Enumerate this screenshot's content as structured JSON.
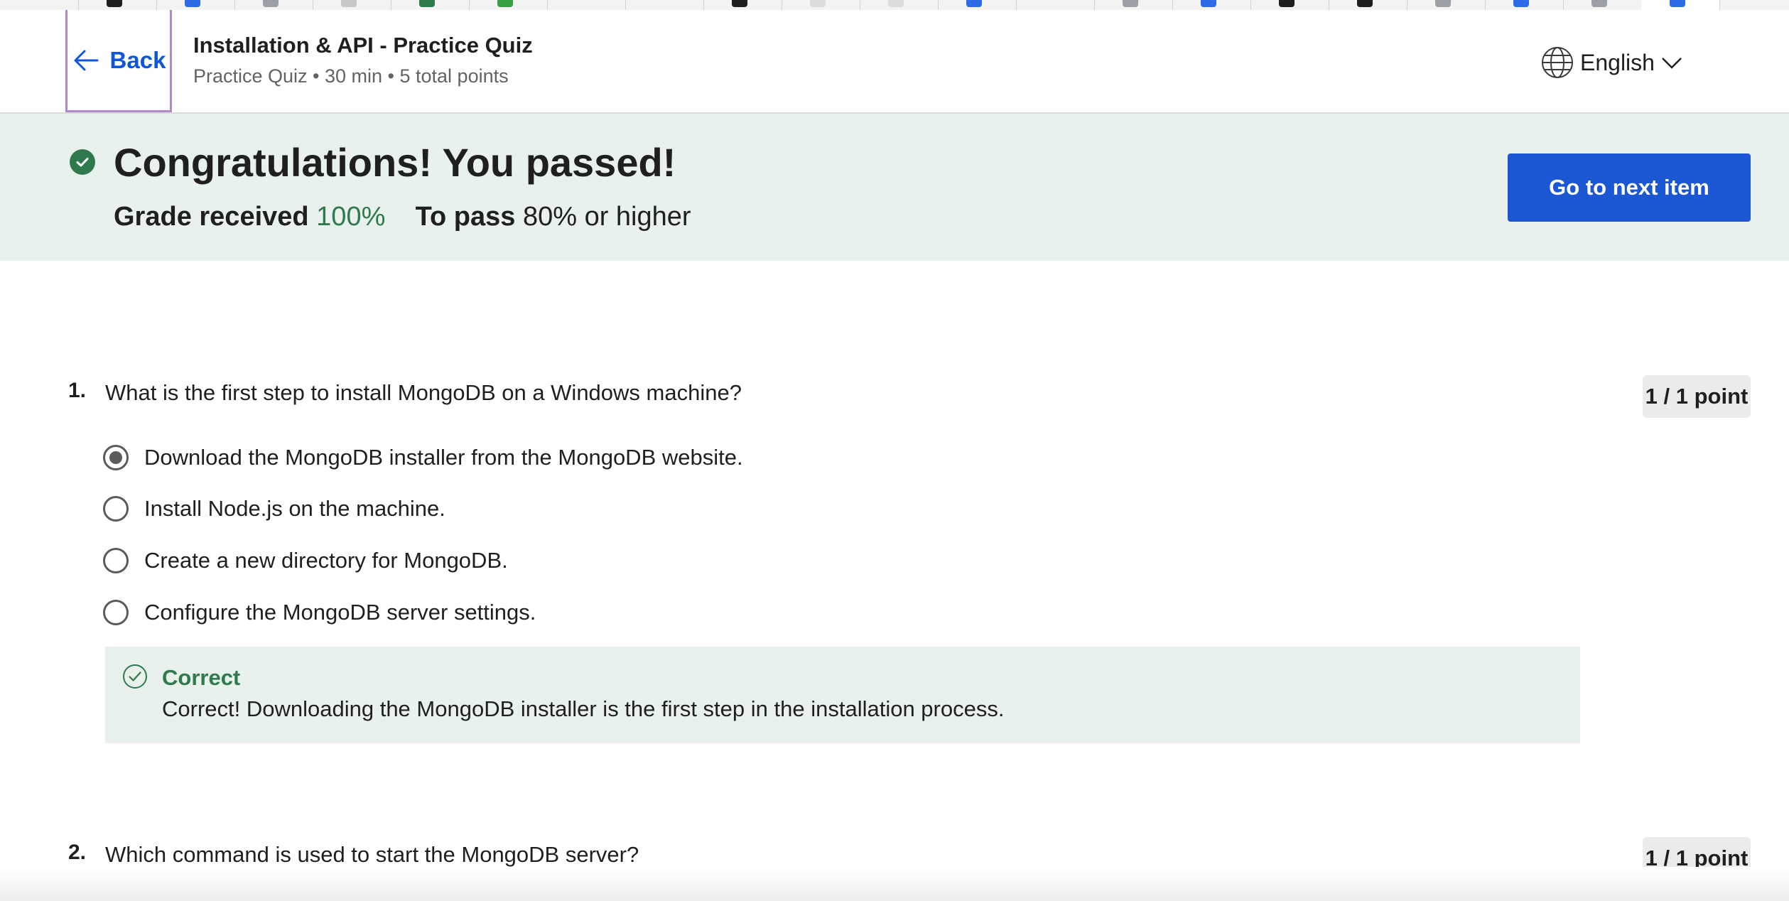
{
  "header": {
    "back_label": "Back",
    "title": "Installation & API - Practice Quiz",
    "subtitle": "Practice Quiz • 30 min • 5 total points",
    "language": "English"
  },
  "result": {
    "heading": "Congratulations! You passed!",
    "grade_label": "Grade received",
    "grade_value": "100%",
    "pass_label": "To pass",
    "pass_value": "80% or higher",
    "next_button": "Go to next item"
  },
  "questions": [
    {
      "number": "1.",
      "text": "What is the first step to install MongoDB on a Windows machine?",
      "points": "1 / 1 point",
      "options": [
        {
          "label": "Download the MongoDB installer from the MongoDB website.",
          "selected": true
        },
        {
          "label": "Install Node.js on the machine.",
          "selected": false
        },
        {
          "label": "Create a new directory for MongoDB.",
          "selected": false
        },
        {
          "label": "Configure the MongoDB server settings.",
          "selected": false
        }
      ],
      "feedback": {
        "title": "Correct",
        "text": "Correct! Downloading the MongoDB installer is the first step in the installation process."
      }
    },
    {
      "number": "2.",
      "text": "Which command is used to start the MongoDB server?",
      "points": "1 / 1 point"
    }
  ],
  "colors": {
    "accent": "#1b56d3",
    "success": "#2f7a4d",
    "success_bg": "#e8f1ec"
  }
}
